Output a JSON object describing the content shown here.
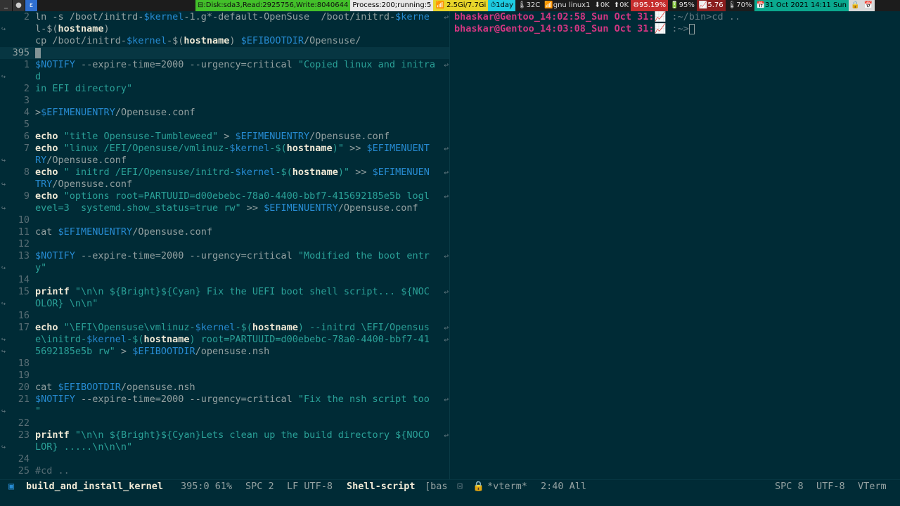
{
  "topbar": {
    "buttons": [
      "_",
      "●",
      "ε"
    ],
    "segments": [
      {
        "text": "⊟:Disk:sda3,Read:2925756,Write:8040644",
        "style": "green"
      },
      {
        "text": "Process:200;running:5",
        "style": "white"
      },
      {
        "text": "📶 2.5Gi/7.7Gi",
        "style": "yellow"
      },
      {
        "text": "⏱1day",
        "style": "cyan"
      },
      {
        "text": "🌡32C",
        "style": "plain"
      },
      {
        "text": "📶gnu linux1",
        "style": "plain"
      },
      {
        "text": "⬇0K",
        "style": "plain"
      },
      {
        "text": "⬆0K",
        "style": "plain"
      },
      {
        "text": "⚙95.19%",
        "style": "red"
      },
      {
        "text": "🔋95%",
        "style": "plain"
      },
      {
        "text": "📈5.76",
        "style": "darkred"
      },
      {
        "text": "🌡70%",
        "style": "plain"
      },
      {
        "text": "📅31 Oct 2021 14:11 Sun",
        "style": "teal"
      },
      {
        "text": "🔒",
        "style": "grey"
      },
      {
        "text": "📅",
        "style": "grey"
      }
    ]
  },
  "editor": {
    "lines": [
      {
        "num": "2",
        "fringe": "",
        "code": [
          [
            "plain",
            "ln -s /boot/initrd-"
          ],
          [
            "var",
            "$kernel"
          ],
          [
            "plain",
            "-1.g*-default-OpenSuse  /boot/initrd-"
          ],
          [
            "var",
            "$kerne"
          ]
        ],
        "wrap": "↩"
      },
      {
        "num": "",
        "fringe": "↪",
        "code": [
          [
            "plain",
            "l-$("
          ],
          [
            "kw",
            "hostname"
          ],
          [
            "plain",
            ")"
          ]
        ]
      },
      {
        "num": "",
        "fringe": "",
        "code": [
          [
            "plain",
            "cp /boot/initrd-"
          ],
          [
            "var",
            "$kernel"
          ],
          [
            "plain",
            "-$("
          ],
          [
            "kw",
            "hostname"
          ],
          [
            "plain",
            ") "
          ],
          [
            "var",
            "$EFIBOOTDIR"
          ],
          [
            "plain",
            "/Opensuse/"
          ]
        ]
      },
      {
        "num": "395",
        "fringe": "",
        "current": true,
        "code": []
      },
      {
        "num": "1",
        "fringe": "",
        "code": [
          [
            "var",
            "$NOTIFY"
          ],
          [
            "plain",
            " --expire-time=2000 --urgency=critical "
          ],
          [
            "str",
            "\"Copied linux and initra"
          ]
        ],
        "wrap": "↩"
      },
      {
        "num": "",
        "fringe": "↪",
        "code": [
          [
            "str",
            "d"
          ]
        ]
      },
      {
        "num": "2",
        "fringe": "",
        "code": [
          [
            "str",
            "in EFI directory\""
          ]
        ]
      },
      {
        "num": "3",
        "fringe": "",
        "code": []
      },
      {
        "num": "4",
        "fringe": "",
        "code": [
          [
            "plain",
            ">"
          ],
          [
            "var",
            "$EFIMENUENTRY"
          ],
          [
            "plain",
            "/Opensuse.conf"
          ]
        ]
      },
      {
        "num": "5",
        "fringe": "",
        "code": []
      },
      {
        "num": "6",
        "fringe": "",
        "code": [
          [
            "kw",
            "echo"
          ],
          [
            "plain",
            " "
          ],
          [
            "str",
            "\"title Opensuse-Tumbleweed\""
          ],
          [
            "plain",
            " > "
          ],
          [
            "var",
            "$EFIMENUENTRY"
          ],
          [
            "plain",
            "/Opensuse.conf"
          ]
        ]
      },
      {
        "num": "7",
        "fringe": "",
        "code": [
          [
            "kw",
            "echo"
          ],
          [
            "plain",
            " "
          ],
          [
            "str",
            "\"linux /EFI/Opensuse/vmlinuz-"
          ],
          [
            "var",
            "$kernel"
          ],
          [
            "str",
            "-$("
          ],
          [
            "kw",
            "hostname"
          ],
          [
            "str",
            ")\""
          ],
          [
            "plain",
            " >> "
          ],
          [
            "var",
            "$EFIMENUENT"
          ]
        ],
        "wrap": "↩"
      },
      {
        "num": "",
        "fringe": "↪",
        "code": [
          [
            "var",
            "RY"
          ],
          [
            "plain",
            "/Opensuse.conf"
          ]
        ]
      },
      {
        "num": "8",
        "fringe": "",
        "code": [
          [
            "kw",
            "echo"
          ],
          [
            "plain",
            " "
          ],
          [
            "str",
            "\" initrd /EFI/Opensuse/initrd-"
          ],
          [
            "var",
            "$kernel"
          ],
          [
            "str",
            "-$("
          ],
          [
            "kw",
            "hostname"
          ],
          [
            "str",
            ")\""
          ],
          [
            "plain",
            " >> "
          ],
          [
            "var",
            "$EFIMENUEN"
          ]
        ],
        "wrap": "↩"
      },
      {
        "num": "",
        "fringe": "↪",
        "code": [
          [
            "var",
            "TRY"
          ],
          [
            "plain",
            "/Opensuse.conf"
          ]
        ]
      },
      {
        "num": "9",
        "fringe": "",
        "code": [
          [
            "kw",
            "echo"
          ],
          [
            "plain",
            " "
          ],
          [
            "str",
            "\"options root=PARTUUID=d00ebebc-78a0-4400-bbf7-415692185e5b logl"
          ]
        ],
        "wrap": "↩"
      },
      {
        "num": "",
        "fringe": "↪",
        "code": [
          [
            "str",
            "evel=3  systemd.show_status=true rw\""
          ],
          [
            "plain",
            " >> "
          ],
          [
            "var",
            "$EFIMENUENTRY"
          ],
          [
            "plain",
            "/Opensuse.conf"
          ]
        ]
      },
      {
        "num": "10",
        "fringe": "",
        "code": []
      },
      {
        "num": "11",
        "fringe": "",
        "code": [
          [
            "plain",
            "cat "
          ],
          [
            "var",
            "$EFIMENUENTRY"
          ],
          [
            "plain",
            "/Opensuse.conf"
          ]
        ]
      },
      {
        "num": "12",
        "fringe": "",
        "code": []
      },
      {
        "num": "13",
        "fringe": "",
        "code": [
          [
            "var",
            "$NOTIFY"
          ],
          [
            "plain",
            " --expire-time=2000 --urgency=critical "
          ],
          [
            "str",
            "\"Modified the boot entr"
          ]
        ],
        "wrap": "↩"
      },
      {
        "num": "",
        "fringe": "↪",
        "code": [
          [
            "str",
            "y\""
          ]
        ]
      },
      {
        "num": "14",
        "fringe": "",
        "code": []
      },
      {
        "num": "15",
        "fringe": "",
        "code": [
          [
            "kw",
            "printf"
          ],
          [
            "plain",
            " "
          ],
          [
            "str",
            "\"\\n\\n ${Bright}${Cyan} Fix the UEFI boot shell script... ${NOC"
          ]
        ],
        "wrap": "↩"
      },
      {
        "num": "",
        "fringe": "↪",
        "code": [
          [
            "str",
            "OLOR} \\n\\n\""
          ]
        ]
      },
      {
        "num": "16",
        "fringe": "",
        "code": []
      },
      {
        "num": "17",
        "fringe": "",
        "code": [
          [
            "kw",
            "echo"
          ],
          [
            "plain",
            " "
          ],
          [
            "str",
            "\"\\EFI\\Opensuse\\vmlinuz-"
          ],
          [
            "var",
            "$kernel"
          ],
          [
            "str",
            "-$("
          ],
          [
            "kw",
            "hostname"
          ],
          [
            "str",
            ") --initrd \\EFI/Opensus"
          ]
        ],
        "wrap": "↩"
      },
      {
        "num": "",
        "fringe": "↪",
        "code": [
          [
            "str",
            "e\\initrd-"
          ],
          [
            "var",
            "$kernel"
          ],
          [
            "str",
            "-$("
          ],
          [
            "kw",
            "hostname"
          ],
          [
            "str",
            ") root=PARTUUID=d00ebebc-78a0-4400-bbf7-41"
          ]
        ],
        "wrap": "↩"
      },
      {
        "num": "",
        "fringe": "↪",
        "code": [
          [
            "str",
            "5692185e5b rw\""
          ],
          [
            "plain",
            " > "
          ],
          [
            "var",
            "$EFIBOOTDIR"
          ],
          [
            "plain",
            "/opensuse.nsh"
          ]
        ]
      },
      {
        "num": "18",
        "fringe": "",
        "code": []
      },
      {
        "num": "19",
        "fringe": "",
        "code": []
      },
      {
        "num": "20",
        "fringe": "",
        "code": [
          [
            "plain",
            "cat "
          ],
          [
            "var",
            "$EFIBOOTDIR"
          ],
          [
            "plain",
            "/opensuse.nsh"
          ]
        ]
      },
      {
        "num": "21",
        "fringe": "",
        "code": [
          [
            "var",
            "$NOTIFY"
          ],
          [
            "plain",
            " --expire-time=2000 --urgency=critical "
          ],
          [
            "str",
            "\"Fix the nsh script too"
          ]
        ],
        "wrap": "↩"
      },
      {
        "num": "",
        "fringe": "↪",
        "code": [
          [
            "str",
            "\""
          ]
        ]
      },
      {
        "num": "22",
        "fringe": "",
        "code": []
      },
      {
        "num": "23",
        "fringe": "",
        "code": [
          [
            "kw",
            "printf"
          ],
          [
            "plain",
            " "
          ],
          [
            "str",
            "\"\\n\\n ${Bright}${Cyan}Lets clean up the build directory ${NOCO"
          ]
        ],
        "wrap": "↩"
      },
      {
        "num": "",
        "fringe": "↪",
        "code": [
          [
            "str",
            "LOR} .....\\n\\n\\n\""
          ]
        ]
      },
      {
        "num": "24",
        "fringe": "",
        "code": []
      },
      {
        "num": "25",
        "fringe": "",
        "code": [
          [
            "cmt",
            "#cd .."
          ]
        ]
      }
    ]
  },
  "terminal": {
    "lines": [
      {
        "user": "bhaskar@Gentoo_14:02:58_Sun Oct 31:",
        "icon": "📈",
        "path": " :~/bin>cd .."
      },
      {
        "user": "bhaskar@Gentoo_14:03:08_Sun Oct 31:",
        "icon": "📈",
        "path": " :~>",
        "cursor": true
      }
    ]
  },
  "modeline": {
    "left": {
      "buffer": "build_and_install_kernel",
      "position": "395:0 61%",
      "indent": "SPC 2",
      "encoding": "LF UTF-8",
      "mode": "Shell-script",
      "submode": "[bas"
    },
    "right": {
      "buffer": "*vterm*",
      "position": "2:40 All",
      "indent": "SPC 8",
      "encoding": "UTF-8",
      "mode": "VTerm"
    }
  }
}
